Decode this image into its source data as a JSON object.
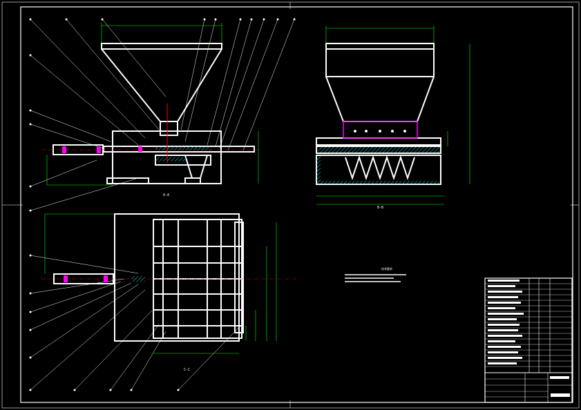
{
  "drawing": {
    "section_labels": {
      "aa": "A-A",
      "bb": "B-B",
      "cc": "C-C"
    },
    "notes_title": "技术要求"
  },
  "colors": {
    "background": "#000000",
    "outline": "#ffffff",
    "dimension": "#00ff00",
    "accent_red": "#ff0000",
    "accent_magenta": "#ff00ff",
    "hatch_cyan": "#00c0c0"
  }
}
